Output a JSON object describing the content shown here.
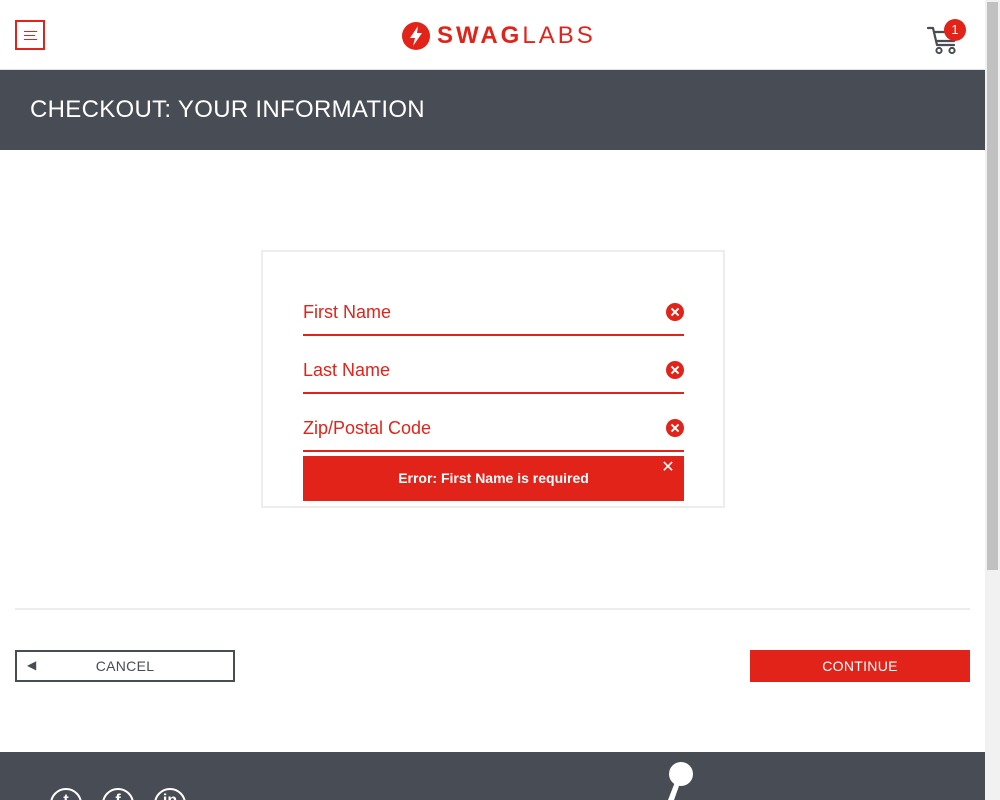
{
  "header": {
    "menu_label": "Open Menu",
    "brand_bold": "SWAG",
    "brand_light": "LABS",
    "cart_count": "1"
  },
  "page_title": "CHECKOUT: YOUR INFORMATION",
  "form": {
    "first_name": {
      "value": "",
      "placeholder": "First Name"
    },
    "last_name": {
      "value": "",
      "placeholder": "Last Name"
    },
    "postal_code": {
      "value": "",
      "placeholder": "Zip/Postal Code"
    },
    "error_message": "Error: First Name is required",
    "error_close": "✕"
  },
  "buttons": {
    "cancel_arrow": "◀",
    "cancel": "CANCEL",
    "continue": "CONTINUE"
  },
  "footer": {
    "twitter_glyph": "t",
    "facebook_glyph": "f",
    "linkedin_glyph": "in"
  },
  "colors": {
    "accent": "#e2231a",
    "dark": "#474c55",
    "card_border": "#ededed"
  }
}
